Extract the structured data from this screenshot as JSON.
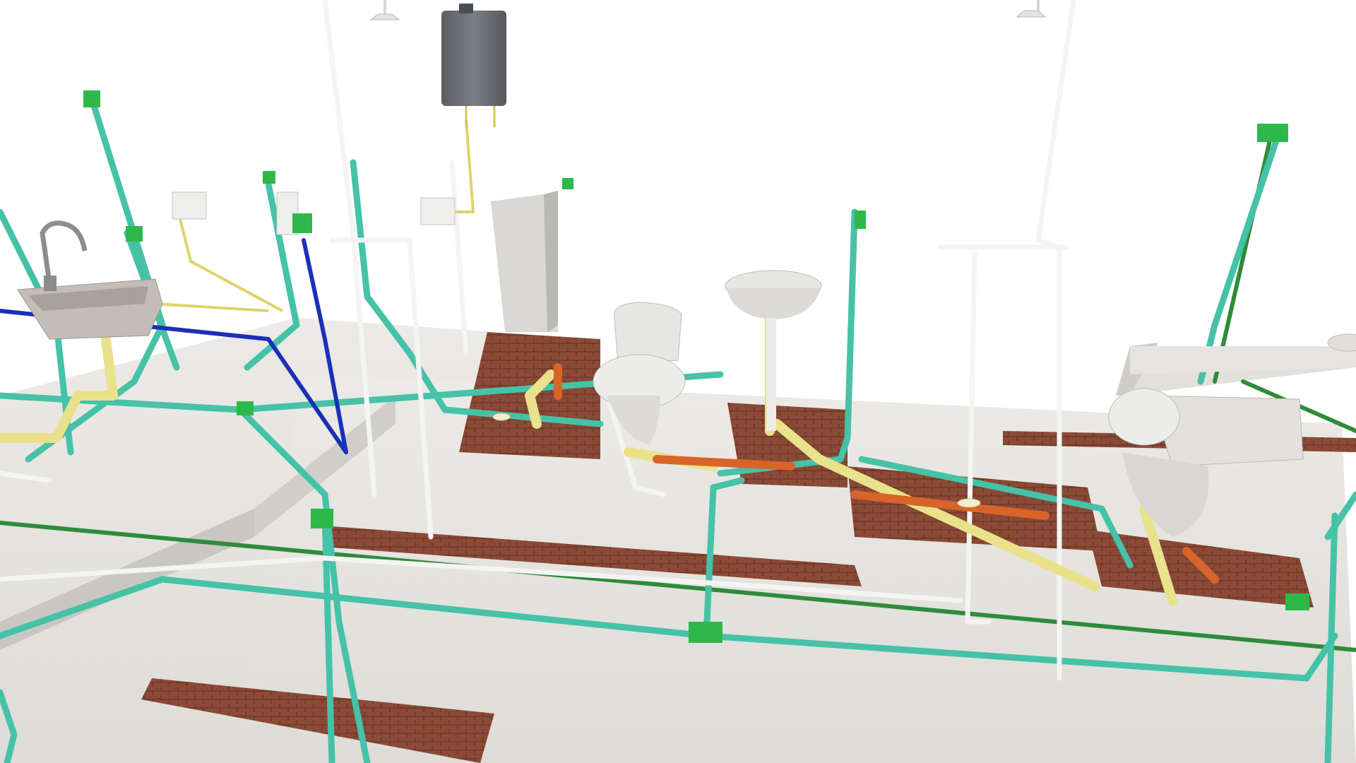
{
  "scene": {
    "description_visible_text": [],
    "colors": {
      "background": "#ffffff",
      "floor": "#e8e7e3",
      "floor_shadow": "#cfcdc8",
      "slab_side": "#c9c7c2",
      "brick": "#8a4a36",
      "brick_dark": "#5e2f22",
      "cold_water_pipe": "#46c2a8",
      "cold_water_pipe_dark": "#2a8f7a",
      "electrical_conduit": "#2e8b3a",
      "drain_pipe": "#e9e28a",
      "drain_pipe_dark": "#b9ae4e",
      "hot_water_pipe": "#ffffff",
      "gas_pipe": "#1b2fb8",
      "sewer_pipe": "#d8642a",
      "fixture": "#e6e6e4",
      "fixture_shadow": "#b9b8b4",
      "water_heater": "#6a6e72",
      "junction_box": "#2fb84a"
    },
    "icons": [
      "sink-icon",
      "toilet-icon",
      "washbasin-icon",
      "shower-head-icon",
      "water-heater-icon",
      "junction-box-icon"
    ]
  }
}
